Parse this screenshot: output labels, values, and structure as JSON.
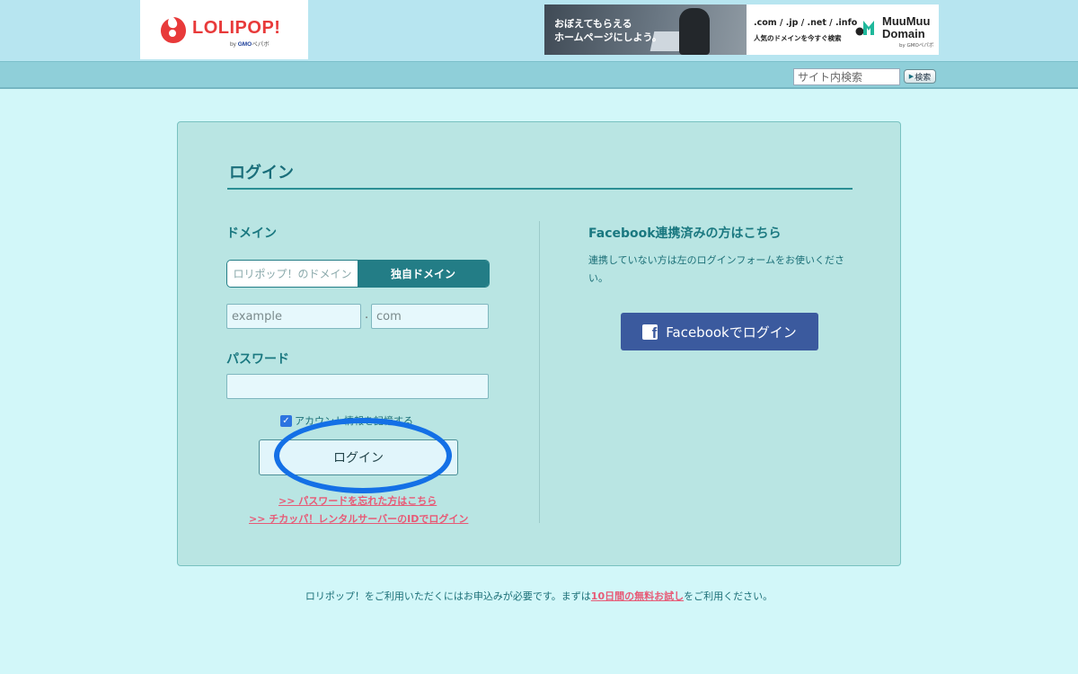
{
  "header": {
    "logo_text": "LOLIPOP!",
    "logo_sub_prefix": "by",
    "logo_sub_brand": "GMO",
    "logo_sub_suffix": "ペパボ",
    "brand_color": "#e83a3a",
    "banner": {
      "line1": "おぼえてもらえる",
      "line2": "ホームページにしよう。",
      "tlds": ".com / .jp / .net / .info",
      "tagline": "人気のドメインを今すぐ検索",
      "brand_line1": "MuuMuu",
      "brand_line2": "Domain",
      "brand_sub": "by GMOペパボ"
    }
  },
  "nav": {
    "search_placeholder": "サイト内検索",
    "search_button": "検索"
  },
  "login": {
    "title": "ログイン",
    "domain_label": "ドメイン",
    "domain_options": [
      "ロリポップ！のドメイン",
      "独自ドメイン"
    ],
    "selected_option": "独自ドメイン",
    "domain_name": {
      "value": "",
      "placeholder": "example"
    },
    "domain_separator": ".",
    "tld": {
      "value": "",
      "placeholder": "com"
    },
    "password_label": "パスワード",
    "password_value": "",
    "remember_label": "アカウント情報を記憶する",
    "remember_checked": true,
    "submit_label": "ログイン",
    "forgot_link": ">> パスワードを忘れた方はこちら",
    "chicappa_link": ">> チカッパ！レンタルサーバーのIDでログイン",
    "accent_color": "#237d86",
    "highlight_color": "#1470e6"
  },
  "facebook": {
    "title": "Facebook連携済みの方はこちら",
    "description": "連携していない方は左のログインフォームをお使いください。",
    "button_label": "Facebookでログイン",
    "icon": "facebook-icon",
    "color": "#3b5a9e"
  },
  "footer": {
    "note_prefix": "ロリポップ！をご利用いただくにはお申込みが必要です。まずは",
    "trial_link": "10日間の無料お試し",
    "note_suffix": "をご利用ください。"
  }
}
